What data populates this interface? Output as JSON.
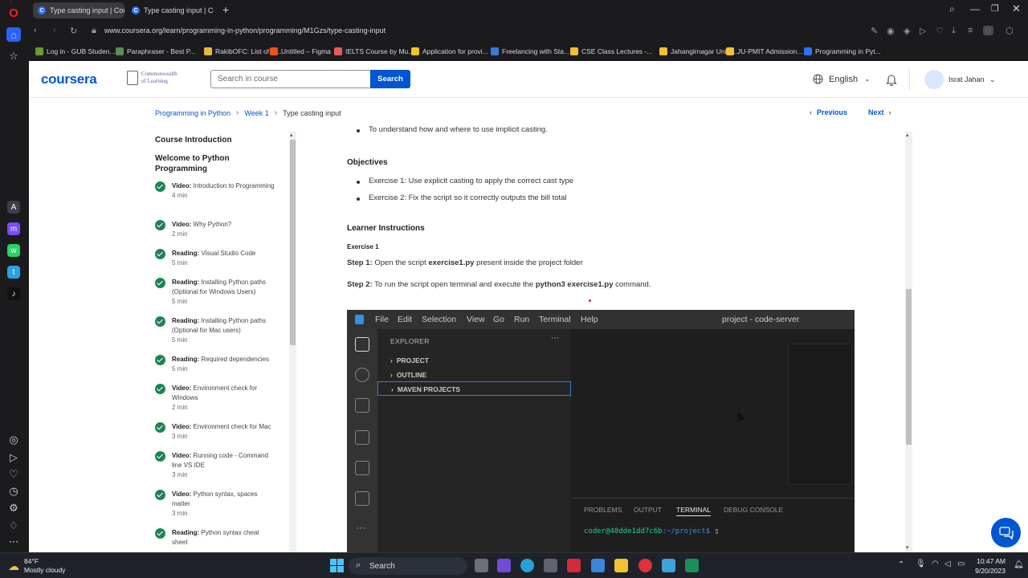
{
  "browser": {
    "tabs": [
      {
        "label": "Type casting input | Cour"
      },
      {
        "label": "Type casting input | Cour"
      }
    ],
    "url": "www.coursera.org/learn/programming-in-python/programming/M1Gzs/type-casting-input",
    "bookmarks": [
      {
        "label": "Log in - GUB Studen...",
        "color": "#6a9a3a"
      },
      {
        "label": "Paraphraser - Best P...",
        "color": "#5b8c5a"
      },
      {
        "label": "RakibOFC: List of C...",
        "color": "#e6b93c"
      },
      {
        "label": "Untitled – Figma",
        "color": "#f24e1e"
      },
      {
        "label": "IELTS Course by Mu...",
        "color": "#e45b5b"
      },
      {
        "label": "Application for provi...",
        "color": "#f2c12e"
      },
      {
        "label": "Freelancing with Sta...",
        "color": "#3a7bd5"
      },
      {
        "label": "CSE Class Lectures -...",
        "color": "#f2c12e"
      },
      {
        "label": "Jahangirnagar Unive...",
        "color": "#f2c12e"
      },
      {
        "label": "JU-PMIT Admission...",
        "color": "#f2c12e"
      },
      {
        "label": "Programming in Pyt...",
        "color": "#2a73ff"
      }
    ]
  },
  "header": {
    "logo": "coursera",
    "partner_line1": "Commonwealth",
    "partner_line2": "of Learning",
    "search_placeholder": "Search in course",
    "search_button": "Search",
    "language": "English",
    "user_name": "Israt Jahan"
  },
  "breadcrumb": {
    "items": [
      "Programming in Python",
      "Week 1",
      "Type casting input"
    ],
    "previous": "Previous",
    "next": "Next"
  },
  "sidebar": {
    "title": "Course Introduction",
    "module": "Welcome to Python Programming",
    "lessons": [
      {
        "type": "Video:",
        "title": "Introduction to Programming",
        "duration": "4 min"
      },
      {
        "type": "Video:",
        "title": "Why Python?",
        "duration": "2 min"
      },
      {
        "type": "Reading:",
        "title": "Visual Studio Code",
        "duration": "5 min"
      },
      {
        "type": "Reading:",
        "title": "Installing Python paths (Optional for Windows Users)",
        "duration": "5 min"
      },
      {
        "type": "Reading:",
        "title": "Installing Python paths (Optional for Mac users)",
        "duration": "5 min"
      },
      {
        "type": "Reading:",
        "title": "Required dependencies",
        "duration": "5 min"
      },
      {
        "type": "Video:",
        "title": "Environment check for Windows",
        "duration": "2 min"
      },
      {
        "type": "Video:",
        "title": "Environment check for Mac",
        "duration": "3 min"
      },
      {
        "type": "Video:",
        "title": "Running code - Command line VS IDE",
        "duration": "3 min"
      },
      {
        "type": "Video:",
        "title": "Python syntax, spaces matter",
        "duration": "3 min"
      },
      {
        "type": "Reading:",
        "title": "Python syntax cheat sheet",
        "duration": ""
      }
    ]
  },
  "content": {
    "cut_bullet": "To understand how and where to use implicit casting.",
    "objectives_heading": "Objectives",
    "objectives": [
      "Exercise 1: Use explicit casting to apply the correct cast type",
      "Exercise 2: Fix the script so it correctly outputs the bill total"
    ],
    "instructions_heading": "Learner Instructions",
    "exercise_label": "Exercise 1",
    "step1_label": "Step 1:",
    "step1_pre": "Open the script",
    "step1_file": "exercise1.py",
    "step1_post": "present inside the project folder",
    "step2_label": "Step 2:",
    "step2_pre": "To run the script open terminal and execute the",
    "step2_cmd": "python3 exercise1.py",
    "step2_post": "command."
  },
  "vscode": {
    "menu": [
      "File",
      "Edit",
      "Selection",
      "View",
      "Go",
      "Run",
      "Terminal",
      "Help"
    ],
    "title": "project - code-server",
    "explorer_title": "EXPLORER",
    "sections": [
      "PROJECT",
      "OUTLINE",
      "MAVEN PROJECTS"
    ],
    "panel_tabs": [
      "PROBLEMS",
      "OUTPUT",
      "TERMINAL",
      "DEBUG CONSOLE"
    ],
    "prompt_user": "coder@48dde1dd7c6b",
    "prompt_path": ":~/project$",
    "arrow_color": "#e02020"
  },
  "taskbar": {
    "temperature": "84°F",
    "weather": "Mostly cloudy",
    "search": "Search",
    "time": "10:47 AM",
    "date": "9/20/2023"
  }
}
